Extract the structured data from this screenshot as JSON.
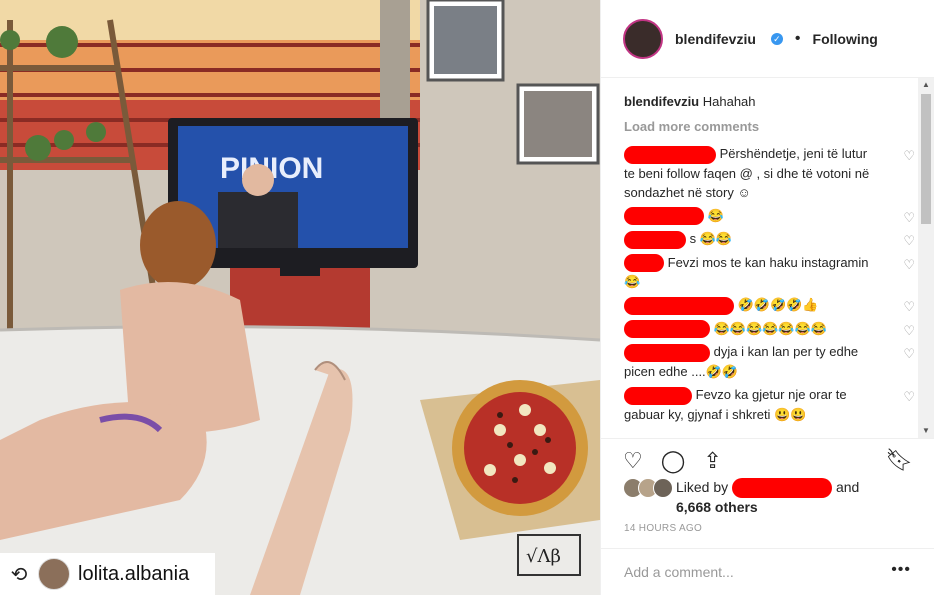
{
  "post": {
    "repost_icon": "repost-icon",
    "repost_user": "lolita.albania",
    "tv_text": "PINION",
    "signature": "√Λβ"
  },
  "header": {
    "username": "blendifevziu",
    "verified_glyph": "✓",
    "dot": "•",
    "follow_label": "Following"
  },
  "comments": {
    "caption_user": "blendifevziu",
    "caption_text": "Hahahah",
    "load_more": "Load more comments",
    "items": [
      {
        "text": "Përshëndetje, jeni të lutur te beni follow faqen @ , si dhe të votoni në sondazhet në story ☺"
      },
      {
        "text": "😂"
      },
      {
        "text": "s 😂😂"
      },
      {
        "text": "Fevzi mos te kan haku instagramin 😂"
      },
      {
        "text": "🤣🤣🤣🤣👍"
      },
      {
        "text": "😂😂😂😂😂😂😂"
      },
      {
        "text": "dyja i kan lan per ty edhe picen edhe ....🤣🤣"
      },
      {
        "text": "Fevzo ka gjetur nje orar te gabuar ky, gjynaf i shkreti 😃😃"
      }
    ]
  },
  "actions": {
    "heart": "heart-icon",
    "comment": "comment-icon",
    "share": "share-icon",
    "save": "bookmark-icon"
  },
  "likes": {
    "prefix": "Liked by",
    "and": "and",
    "others": "6,668 others"
  },
  "timestamp": "14 HOURS AGO",
  "add_comment": {
    "placeholder": "Add a comment...",
    "more": "•••"
  }
}
